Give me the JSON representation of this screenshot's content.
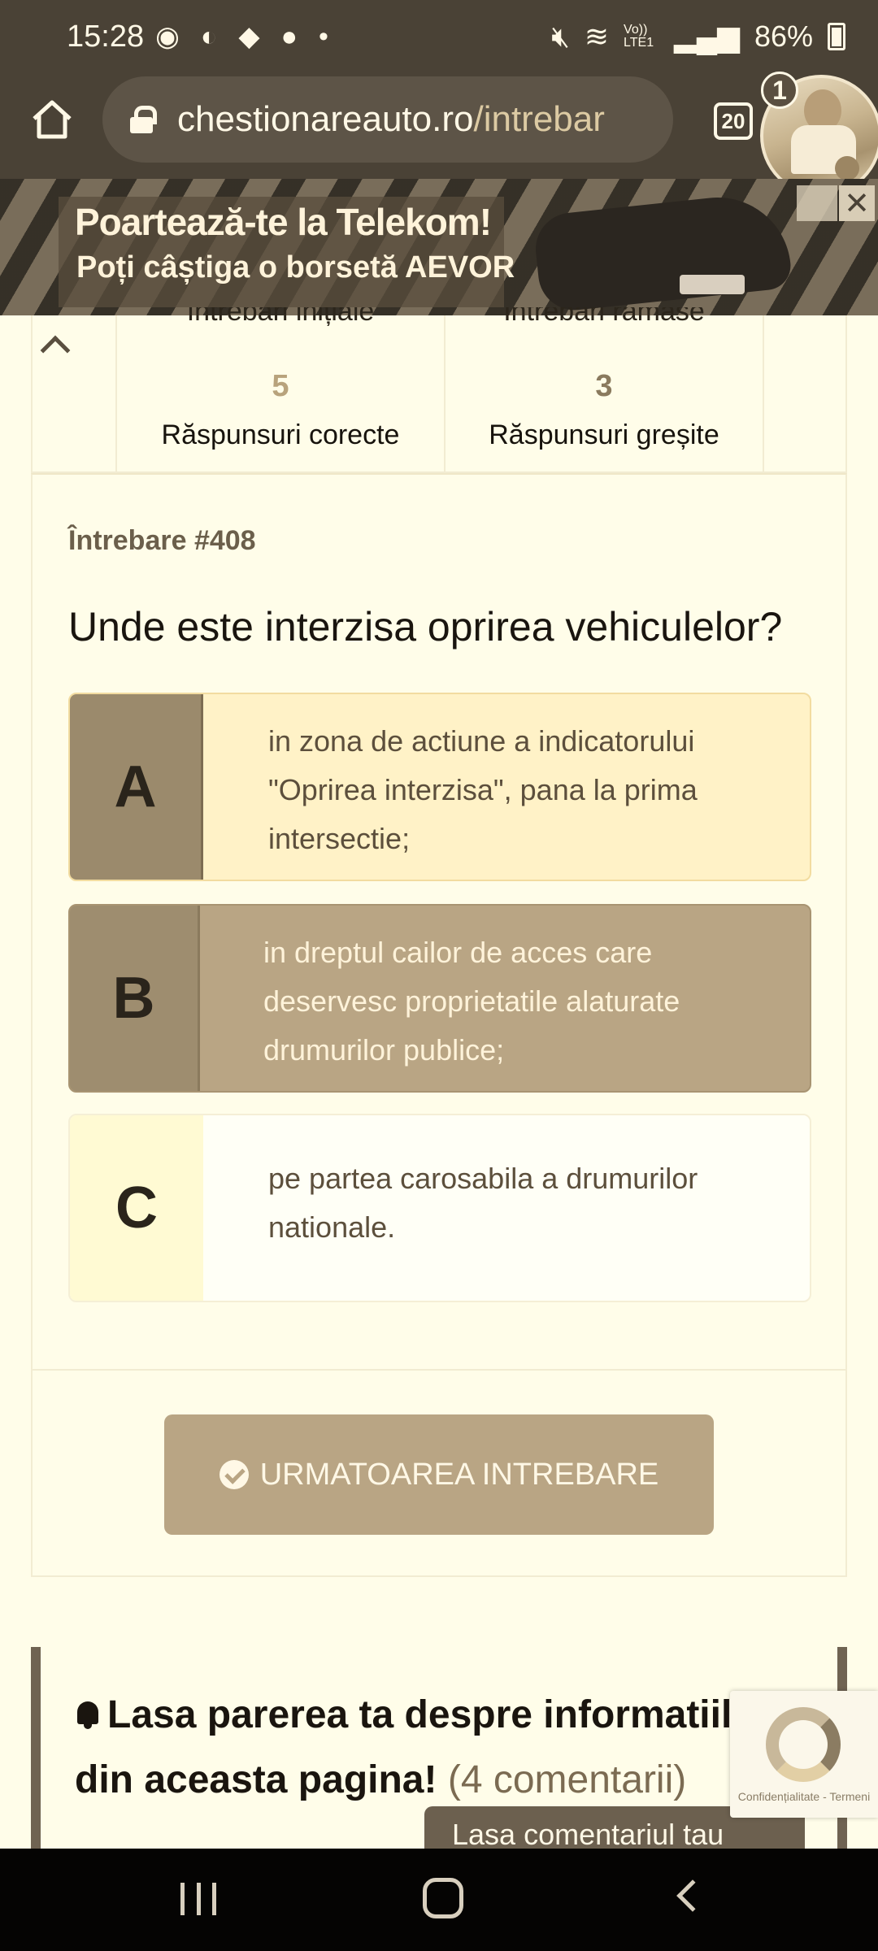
{
  "status_bar": {
    "time": "15:28",
    "battery": "86%",
    "network": "Vo)) LTE1",
    "icons": [
      "media-icon",
      "messenger-icon",
      "discord-icon",
      "facebook-icon",
      "dot-icon",
      "mute-icon",
      "wifi-icon",
      "signal-icon",
      "battery-icon"
    ]
  },
  "browser": {
    "url_host": "chestionareauto.ro",
    "url_path": "/intrebar",
    "tab_count": "20"
  },
  "bubble": {
    "badge": "1"
  },
  "ad": {
    "line1": "Poartează-te la Telekom!",
    "line2": "Poți câștiga o borsetă AEVOR"
  },
  "stats": {
    "top_left_cut": "Întrebări inițiale",
    "top_right_cut": "Întrebări rămase",
    "correct_count": "5",
    "correct_label": "Răspunsuri corecte",
    "wrong_count": "3",
    "wrong_label": "Răspunsuri greșite"
  },
  "question": {
    "number_label": "Întrebare #408",
    "title": "Unde este interzisa oprirea vehiculelor?",
    "answers": [
      {
        "letter": "A",
        "text": "in zona de actiune a indicatorului \"Oprirea interzisa\", pana la prima intersectie;"
      },
      {
        "letter": "B",
        "text": "in dreptul cailor de acces care deservesc proprietatile alaturate drumurilor publice;"
      },
      {
        "letter": "C",
        "text": "pe partea carosabila a drumurilor nationale."
      }
    ],
    "next_button": "URMATOAREA INTREBARE"
  },
  "comments": {
    "title": "Lasa parerea ta despre informatiile din aceasta pagina!",
    "count": "(4 comentarii)",
    "button": "Lasa comentariul tau"
  },
  "recaptcha": {
    "terms": "Confidențialitate - Termeni"
  },
  "colors": {
    "status_bar_bg": "#4a4236",
    "page_bg": "#fffde9",
    "selected_answer_bg": "#b9a584",
    "highlight_answer_bg": "#fff2c7",
    "primary_button": "#b9a584"
  }
}
